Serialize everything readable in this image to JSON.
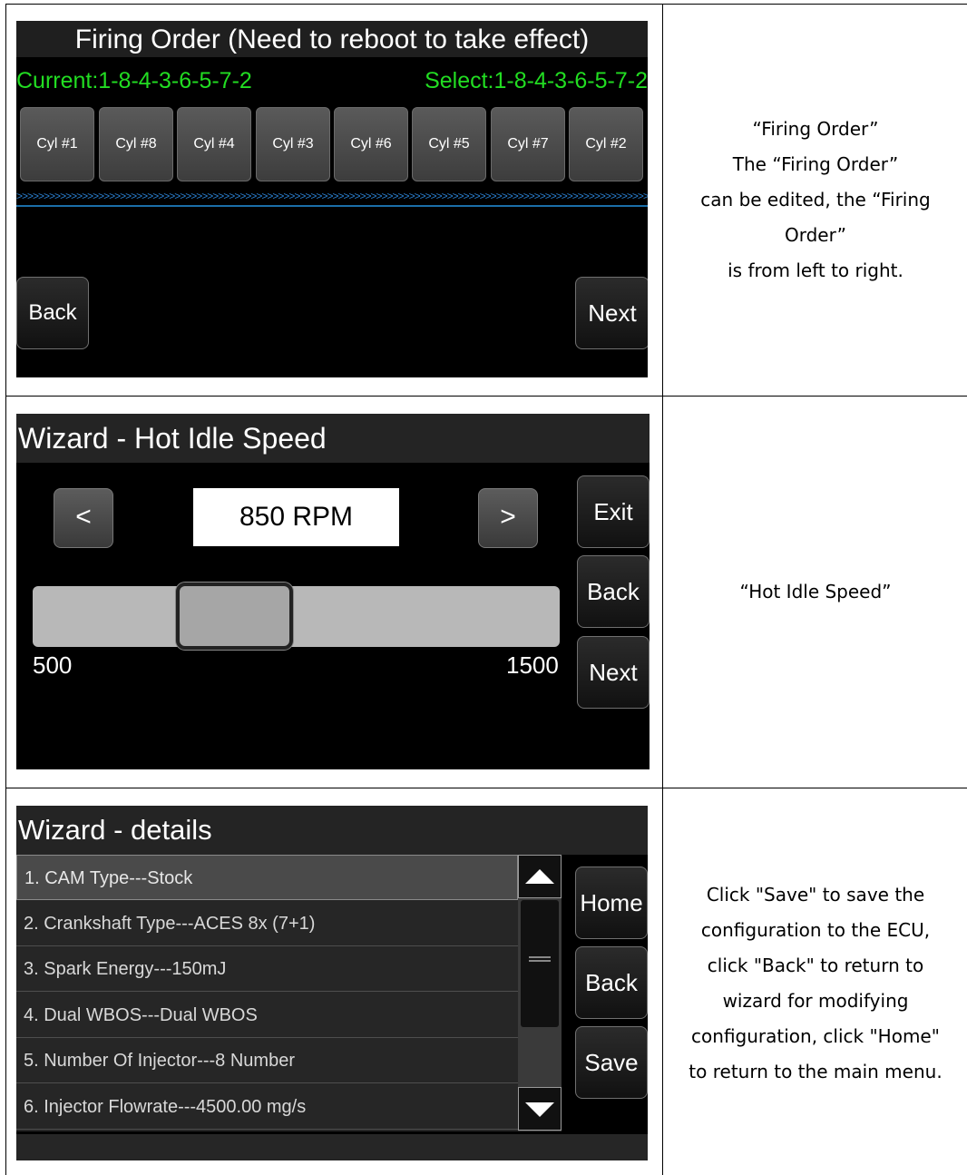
{
  "rows": [
    {
      "title": "Firing Order (Need to reboot to take effect)",
      "current": "Current:1-8-4-3-6-5-7-2",
      "select": "Select:1-8-4-3-6-5-7-2",
      "cylinders": [
        "Cyl #1",
        "Cyl #8",
        "Cyl #4",
        "Cyl #3",
        "Cyl #6",
        "Cyl #5",
        "Cyl #7",
        "Cyl #2"
      ],
      "arrows": ">>>>>>>>>>>>>>>>>>>>>>>>>>>>>>>>>>>>>>>>>>>>>>>>>>>>>>>>>>>>>>>>>>>>>>>>>>>>>>>>>>>>>>>>>>>>>>>>>>>>>>>>>>>>>>>>>>>>>>>>",
      "back_label": "Back",
      "next_label": "Next",
      "description": [
        "“Firing Order”",
        "The “Firing Order”",
        "can be edited, the “Firing",
        "Order”",
        "is from left to right."
      ]
    },
    {
      "title": "Wizard - Hot Idle Speed",
      "decrement_label": "<",
      "increment_label": ">",
      "value": "850 RPM",
      "slider_min": "500",
      "slider_max": "1500",
      "slider_value": 850,
      "exit_label": "Exit",
      "back_label": "Back",
      "next_label": "Next",
      "description": [
        "“Hot Idle Speed”"
      ]
    },
    {
      "title": "Wizard - details",
      "items": [
        "1. CAM Type---Stock",
        "2. Crankshaft Type---ACES 8x (7+1)",
        "3. Spark Energy---150mJ",
        "4. Dual WBOS---Dual WBOS",
        "5. Number Of Injector---8 Number",
        "6. Injector Flowrate---4500.00 mg/s"
      ],
      "selected_index": 0,
      "home_label": "Home",
      "back_label": "Back",
      "save_label": "Save",
      "description": [
        "Click \"Save\" to save the",
        "configuration to the ECU,",
        "click \"Back\" to return to",
        "wizard for modifying",
        "configuration, click \"Home\"",
        "to return to the main menu."
      ]
    }
  ],
  "colors": {
    "status_text": "#22dd22",
    "screen_bg": "#000000",
    "title_bar": "#242424",
    "arrow_line": "#1b6ea8"
  }
}
